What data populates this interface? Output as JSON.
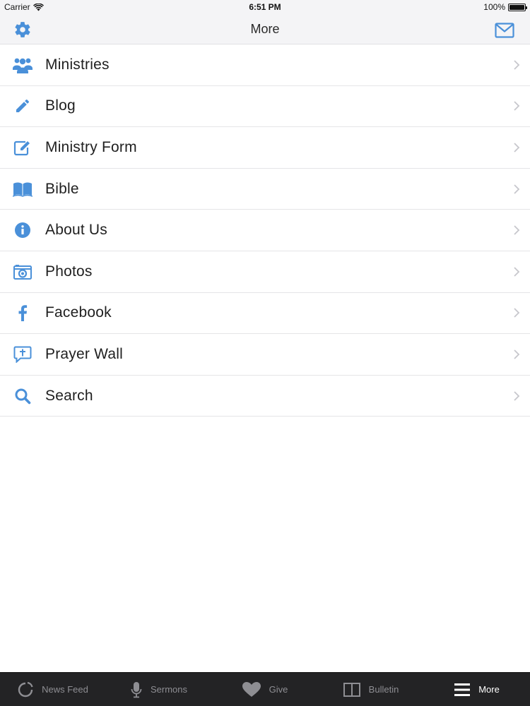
{
  "status_bar": {
    "carrier": "Carrier",
    "time": "6:51 PM",
    "battery": "100%",
    "battery_level": 1.0
  },
  "nav": {
    "title": "More",
    "left_icon": "gear-icon",
    "right_icon": "mail-icon"
  },
  "menu": {
    "items": [
      {
        "label": "Ministries",
        "icon": "users-icon"
      },
      {
        "label": "Blog",
        "icon": "pencil-icon"
      },
      {
        "label": "Ministry Form",
        "icon": "edit-form-icon"
      },
      {
        "label": "Bible",
        "icon": "book-icon"
      },
      {
        "label": "About Us",
        "icon": "info-icon"
      },
      {
        "label": "Photos",
        "icon": "camera-icon"
      },
      {
        "label": "Facebook",
        "icon": "facebook-icon"
      },
      {
        "label": "Prayer Wall",
        "icon": "prayer-bubble-icon"
      },
      {
        "label": "Search",
        "icon": "search-icon"
      }
    ]
  },
  "tab_bar": {
    "tabs": [
      {
        "label": "News Feed",
        "icon": "news-feed-icon",
        "active": false
      },
      {
        "label": "Sermons",
        "icon": "microphone-icon",
        "active": false
      },
      {
        "label": "Give",
        "icon": "heart-icon",
        "active": false
      },
      {
        "label": "Bulletin",
        "icon": "bulletin-icon",
        "active": false
      },
      {
        "label": "More",
        "icon": "menu-icon",
        "active": true
      }
    ]
  },
  "colors": {
    "accent": "#4a90d9",
    "tab_bar_bg": "#232325",
    "tab_inactive": "#8e8e93",
    "tab_active": "#ffffff"
  }
}
